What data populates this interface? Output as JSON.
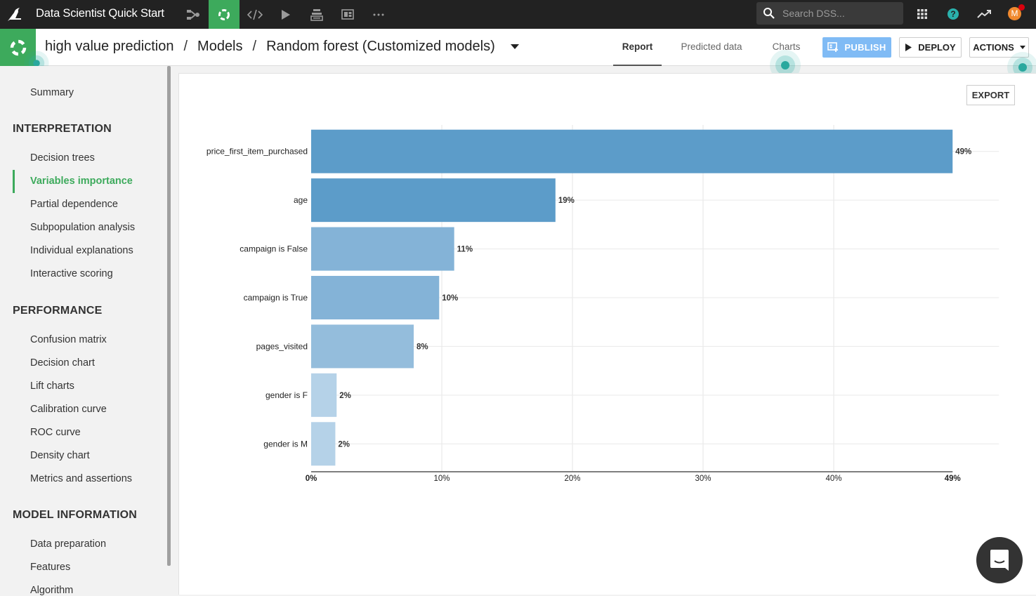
{
  "topbar": {
    "app_title": "Data Scientist Quick Start",
    "nav_icons": [
      "flow-icon",
      "lab-icon",
      "code-icon",
      "run-icon",
      "datasets-icon",
      "dashboard-icon",
      "more-icon"
    ],
    "search_placeholder": "Search DSS...",
    "avatar_initial": "M"
  },
  "subbar": {
    "breadcrumb": [
      "high value prediction",
      "Models",
      "Random forest (Customized models)"
    ],
    "separator": "/",
    "tabs": [
      {
        "label": "Report",
        "active": true
      },
      {
        "label": "Predicted data",
        "active": false
      },
      {
        "label": "Charts",
        "active": false
      }
    ],
    "publish_label": "PUBLISH",
    "deploy_label": "DEPLOY",
    "actions_label": "ACTIONS"
  },
  "sidebar": {
    "summary": "Summary",
    "sections": [
      {
        "title": "INTERPRETATION",
        "items": [
          "Decision trees",
          "Variables importance",
          "Partial dependence",
          "Subpopulation analysis",
          "Individual explanations",
          "Interactive scoring"
        ]
      },
      {
        "title": "PERFORMANCE",
        "items": [
          "Confusion matrix",
          "Decision chart",
          "Lift charts",
          "Calibration curve",
          "ROC curve",
          "Density chart",
          "Metrics and assertions"
        ]
      },
      {
        "title": "MODEL INFORMATION",
        "items": [
          "Data preparation",
          "Features",
          "Algorithm"
        ]
      }
    ],
    "active_item": "Variables importance"
  },
  "main": {
    "export_label": "EXPORT"
  },
  "colors": {
    "accent_green": "#3daa5c",
    "publish_blue": "#80bbf5",
    "teal": "#2ab1ac"
  },
  "chart_data": {
    "type": "bar",
    "orientation": "horizontal",
    "title": "",
    "xlabel": "",
    "ylabel": "",
    "categories": [
      "price_first_item_purchased",
      "age",
      "campaign is False",
      "campaign is True",
      "pages_visited",
      "gender is F",
      "gender is M"
    ],
    "values": [
      49.1,
      18.7,
      10.95,
      9.8,
      7.85,
      1.95,
      1.85
    ],
    "value_labels": [
      "49%",
      "19%",
      "11%",
      "10%",
      "8%",
      "2%",
      "2%"
    ],
    "bar_colors": [
      "#5799c7",
      "#5799c7",
      "#80b1d6",
      "#80b1d6",
      "#91bbdb",
      "#b3d1e7",
      "#b3d1e7"
    ],
    "xlim": [
      0,
      49.1
    ],
    "xticks": [
      0,
      10,
      20,
      30,
      40,
      49.1
    ],
    "xtick_labels": [
      "0%",
      "10%",
      "20%",
      "30%",
      "40%",
      "49%"
    ],
    "grid": true,
    "legend": "none"
  }
}
